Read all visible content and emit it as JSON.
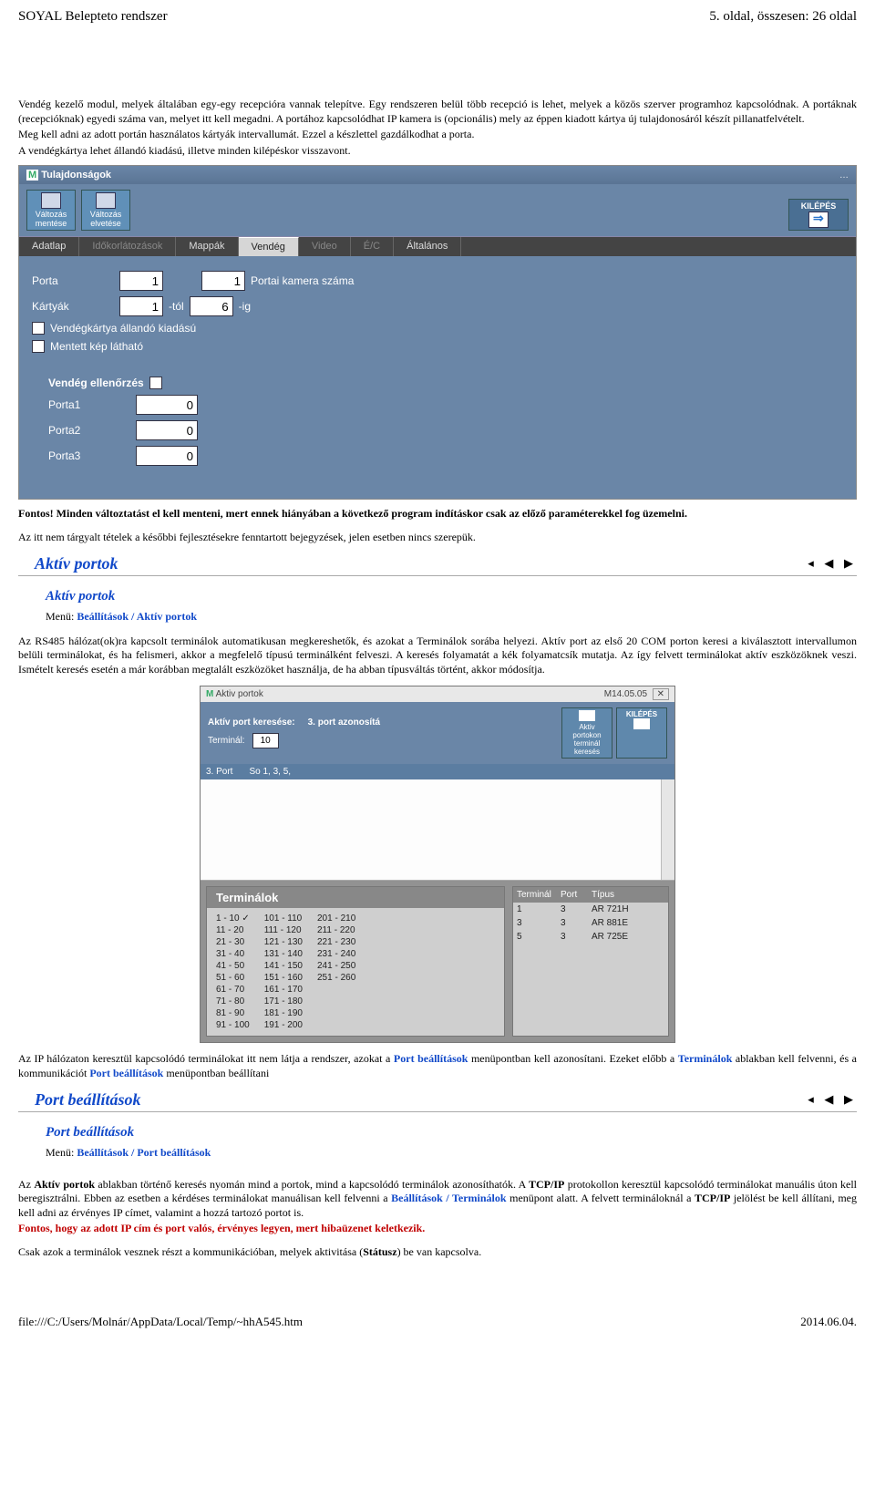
{
  "page_header": {
    "left": "SOYAL Belepteto rendszer",
    "right": "5. oldal, összesen: 26 oldal"
  },
  "intro_paragraph": "Vendég kezelő modul, melyek általában egy-egy recepcióra vannak telepítve. Egy rendszeren belül több recepció is lehet, melyek a közös szerver programhoz kapcsolódnak. A portáknak (recepcióknak) egyedi száma van, melyet itt kell megadni. A portához kapcsolódhat IP kamera is (opcionális) mely az éppen kiadott kártya új tulajdonosáról készít pillanatfelvételt.",
  "intro_line2": "Meg kell adni az adott portán használatos kártyák intervallumát. Ezzel a készlettel gazdálkodhat a porta.",
  "intro_line3": "A vendégkártya lehet állandó kiadású, illetve minden kilépéskor visszavont.",
  "win1": {
    "title": "Tulajdonságok",
    "toolbar": {
      "save": "Változás mentése",
      "discard": "Változás elvetése",
      "exit": "KILÉPÉS"
    },
    "tabs": [
      "Adatlap",
      "Időkorlátozások",
      "Mappák",
      "Vendég",
      "Video",
      "É/C",
      "Általános"
    ],
    "active_tab": "Vendég",
    "form": {
      "porta_label": "Porta",
      "porta_val": "1",
      "porta_cam_val": "1",
      "porta_cam_label": "Portai kamera száma",
      "kartyak_label": "Kártyák",
      "kartyak_from": "1",
      "from_suffix": "-tól",
      "kartyak_to": "6",
      "to_suffix": "-ig",
      "chk1": "Vendégkártya állandó kiadású",
      "chk2": "Mentett kép látható",
      "guest_chk_label": "Vendég ellenőrzés",
      "p1_label": "Porta1",
      "p1_val": "0",
      "p2_label": "Porta2",
      "p2_val": "0",
      "p3_label": "Porta3",
      "p3_val": "0"
    }
  },
  "fontos_prefix": "Fontos!",
  "fontos_text": " Minden változtatást el kell menteni, mert ennek hiányában a következő program indításkor csak az előző paraméterekkel fog üzemelni.",
  "note_line": "Az itt nem tárgyalt tételek a későbbi fejlesztésekre fenntartott bejegyzések, jelen esetben nincs szerepük.",
  "section_aktiv": {
    "title": "Aktív portok",
    "subtitle": "Aktív portok",
    "menu_label": "Menü: ",
    "menu_path": "Beállítások / Aktív portok",
    "para1": "Az  RS485 hálózat(ok)ra kapcsolt terminálok automatikusan megkereshetők, és azokat a Terminálok sorába helyezi. Aktív port  az első 20 COM porton keresi a kiválasztott intervallumon belüli terminálokat, és ha felismeri, akkor a megfelelő típusú terminálként felveszi. A keresés folyamatát a kék folyamatcsík mutatja. Az így felvett terminálokat aktív eszközöknek veszi. Ismételt keresés esetén a már korábban megtalált eszközöket használja, de ha abban típusváltás történt, akkor módosítja."
  },
  "win2": {
    "title_left": "Aktiv portok",
    "title_m": "M",
    "title_right": "M14.05.05",
    "close": "✕",
    "bar_label": "Aktív port keresése:",
    "bar_status": "3. port azonosítá",
    "terminal_label": "Terminál:",
    "terminal_val": "10",
    "tb_search": "Aktiv portokon terminál keresés",
    "tb_exit": "KILÉPÉS",
    "list_port": "3. Port",
    "list_so": "So 1, 3, 5,",
    "term_title": "Terminálok",
    "ranges_col1": [
      "1  -  10 ✓",
      "11  -  20",
      "21  -  30",
      "31  -  40",
      "41  -  50",
      "51  -  60",
      "61  -  70",
      "71  -  80",
      "81  -  90",
      "91  - 100"
    ],
    "ranges_col2": [
      "101 - 110",
      "111 - 120",
      "121 - 130",
      "131 - 140",
      "141 - 150",
      "151 - 160",
      "161 - 170",
      "171 - 180",
      "181 - 190",
      "191 - 200"
    ],
    "ranges_col3": [
      "201 - 210",
      "211 - 220",
      "221 - 230",
      "231 - 240",
      "241 - 250",
      "251 - 260"
    ],
    "right_hdr": [
      "Terminál",
      "Port",
      "Típus"
    ],
    "right_rows": [
      [
        "1",
        "3",
        "AR 721H"
      ],
      [
        "3",
        "3",
        "AR 881E"
      ],
      [
        "5",
        "3",
        "AR 725E"
      ]
    ]
  },
  "after_win2_a": "Az IP hálózaton keresztül kapcsolódó terminálokat itt nem látja a rendszer, azokat a ",
  "after_win2_b": "Port beállítások",
  "after_win2_c": " menüpontban kell azonosítani. Ezeket előbb a ",
  "after_win2_d": "Terminálok",
  "after_win2_e": " ablakban kell felvenni, és a kommunikációt ",
  "after_win2_f": "Port beállítások",
  "after_win2_g": " menüpontban beállítani",
  "section_port": {
    "title": "Port beállítások",
    "subtitle": "Port beállítások",
    "menu_label": "Menü: ",
    "menu_path": "Beállítások / Port beállítások",
    "para_a": "Az ",
    "para_a2": "Aktív portok",
    "para_b": " ablakban történő keresés nyomán mind a portok, mind a kapcsolódó terminálok azonosíthatók. A ",
    "para_b2": "TCP/IP",
    "para_c": " protokollon keresztül kapcsolódó terminálokat manuális úton kell beregisztrálni. Ebben az esetben a kérdéses terminálokat manuálisan kell felvenni a ",
    "para_c2": "Beállítások / Terminálok",
    "para_d": " menüpont alatt. A felvett termináloknál a ",
    "para_d2": "TCP/IP",
    "para_e": " jelölést be kell állítani, meg kell adni az érvényes IP címet, valamint a hozzá tartozó portot is.",
    "red_line": "Fontos, hogy az adott IP cím és port valós, érvényes legyen, mert hibaüzenet keletkezik.",
    "last_a": "Csak azok a terminálok vesznek részt a kommunikációban, melyek aktivitása (",
    "last_b": "Státusz",
    "last_c": ") be van kapcsolva."
  },
  "footer": {
    "left": "file:///C:/Users/Molnár/AppData/Local/Temp/~hhA545.htm",
    "right": "2014.06.04."
  }
}
